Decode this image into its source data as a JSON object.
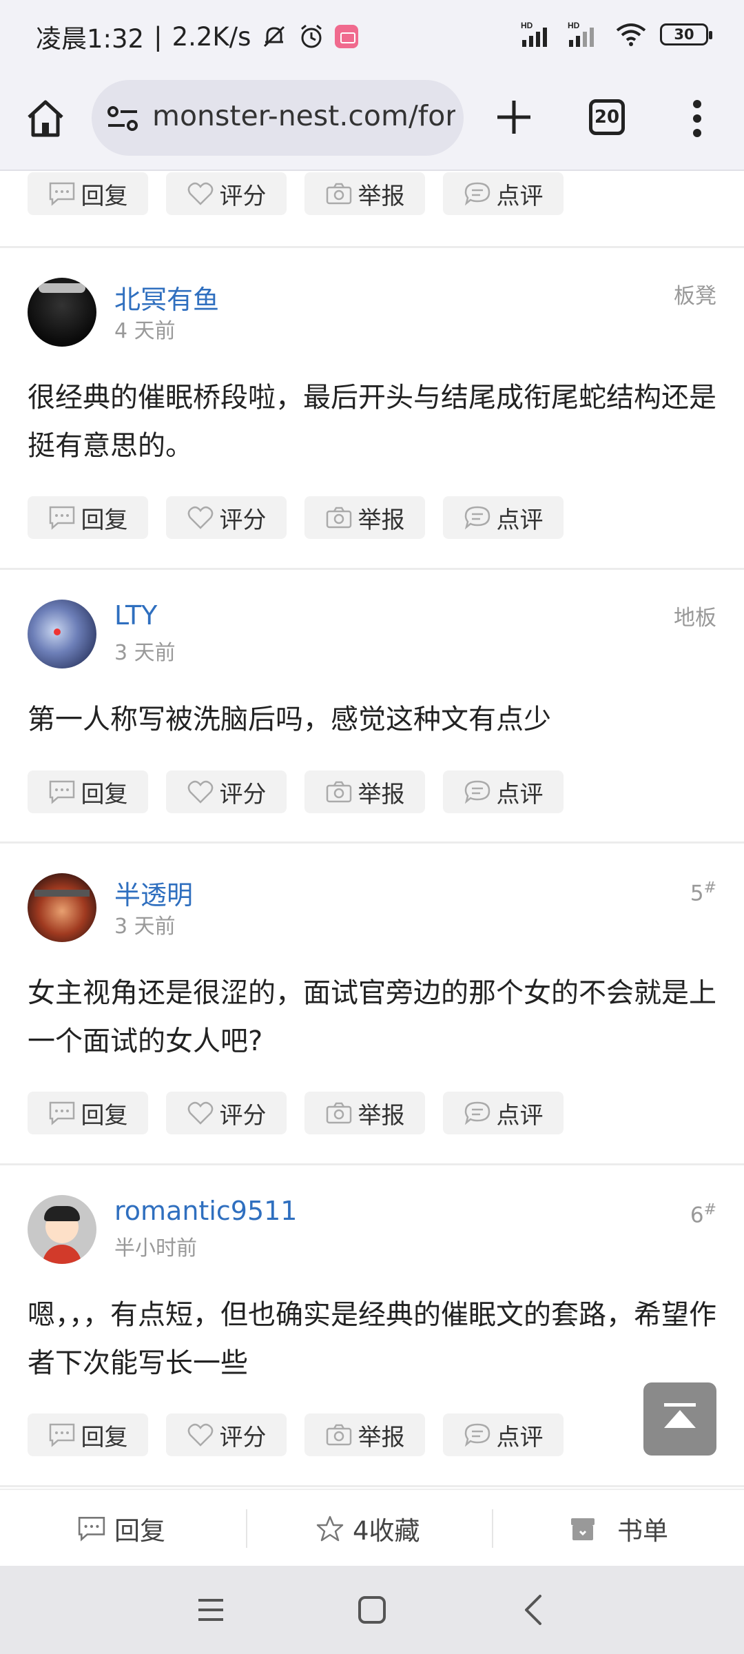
{
  "status_bar": {
    "time": "凌晨1:32",
    "net_speed": "2.2K/s",
    "battery": "30",
    "hd1": "HD",
    "hd2": "HD"
  },
  "browser": {
    "url": "monster-nest.com/forum",
    "tab_count": "20"
  },
  "actions": {
    "reply": "回复",
    "rate": "评分",
    "report": "举报",
    "comment": "点评"
  },
  "posts": [
    {
      "author": "北冥有鱼",
      "time": "4 天前",
      "floor": "板凳",
      "text": "很经典的催眠桥段啦，最后开头与结尾成衔尾蛇结构还是挺有意思的。"
    },
    {
      "author": "LTY",
      "time": "3 天前",
      "floor": "地板",
      "text": "第一人称写被洗脑后吗，感觉这种文有点少"
    },
    {
      "author": "半透明",
      "time": "3 天前",
      "floor": "5",
      "floor_mark": "#",
      "text": "女主视角还是很涩的，面试官旁边的那个女的不会就是上一个面试的女人吧?"
    },
    {
      "author": "romantic9511",
      "time": "半小时前",
      "floor": "6",
      "floor_mark": "#",
      "text": "嗯，，，有点短，但也确实是经典的催眠文的套路，希望作者下次能写长一些"
    }
  ],
  "bottom_bar": {
    "reply": "回复",
    "favorite": "4收藏",
    "booklist": "书单"
  },
  "colors": {
    "username": "#2f6fbf",
    "browser_bg": "#f2f2f7",
    "action_bg": "#f2f2f2"
  }
}
